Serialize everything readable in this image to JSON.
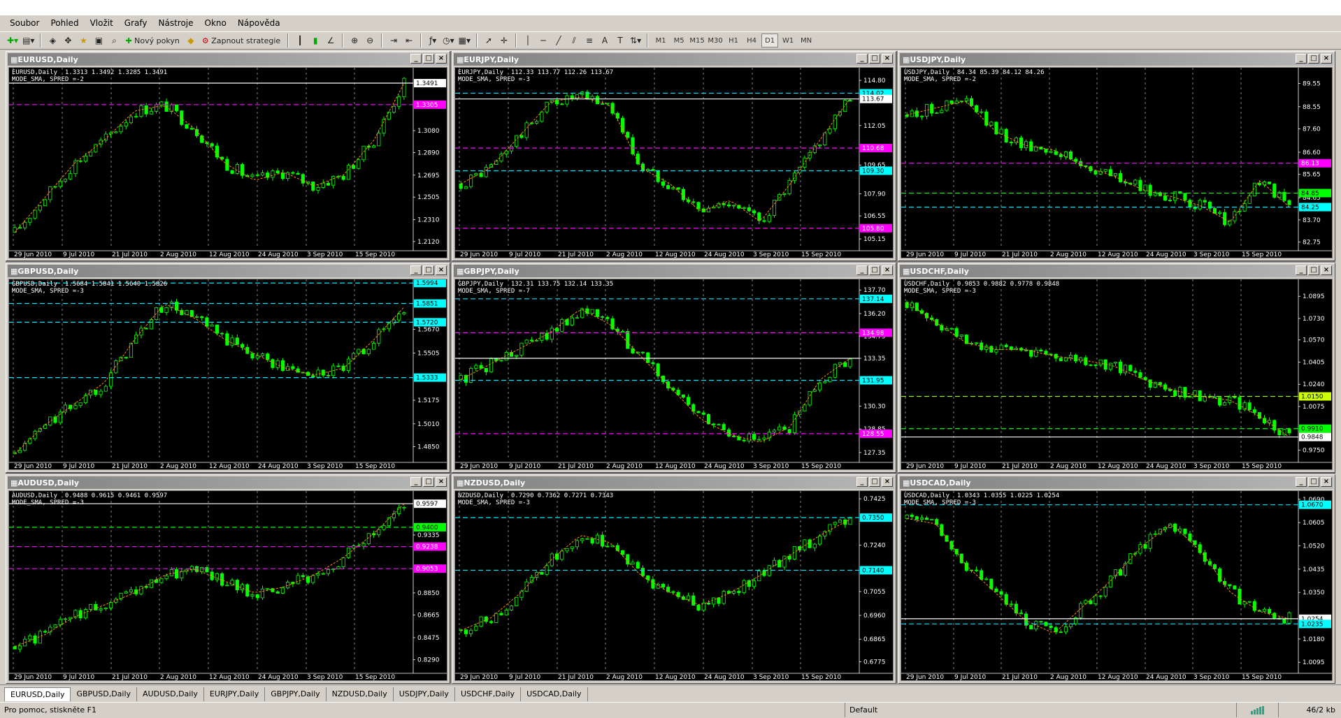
{
  "menu": [
    "Soubor",
    "Pohled",
    "Vložit",
    "Grafy",
    "Nástroje",
    "Okno",
    "Nápověda"
  ],
  "toolbar": {
    "new_order": "Nový pokyn",
    "strategies": "Zapnout strategie",
    "timeframes": [
      "M1",
      "M5",
      "M15",
      "M30",
      "H1",
      "H4",
      "D1",
      "W1",
      "MN"
    ]
  },
  "charts": [
    {
      "title": "EURUSD,Daily",
      "ohlc": "EURUSD,Daily  1.3313 1.3492 1.3285 1.3491",
      "mode": "MODE_SMA, SPRED =-2",
      "chart_data": {
        "type": "candlestick",
        "ylim": [
          1.2065,
          1.36
        ],
        "trend": [
          1.22,
          1.25,
          1.28,
          1.3,
          1.325,
          1.33,
          1.31,
          1.28,
          1.265,
          1.272,
          1.26,
          1.27,
          1.3,
          1.349
        ],
        "scale": [
          "1.3080",
          "1.2890",
          "1.2695",
          "1.2505",
          "1.2310",
          "1.2120"
        ],
        "levels": [
          {
            "v": 1.3491,
            "label": "1.3491",
            "color": "#ffffff",
            "bg": "#ffffff",
            "fg": "#000000"
          },
          {
            "v": 1.3305,
            "label": "1.3305",
            "color": "#ff00ff",
            "bg": "#ff00ff",
            "fg": "#ffffff"
          }
        ],
        "dates": [
          "29 Jun 2010",
          "9 Jul 2010",
          "21 Jul 2010",
          "2 Aug 2010",
          "12 Aug 2010",
          "24 Aug 2010",
          "3 Sep 2010",
          "15 Sep 2010"
        ]
      }
    },
    {
      "title": "EURJPY,Daily",
      "ohlc": "EURJPY,Daily  112.33 113.77 112.26 113.67",
      "mode": "MODE_SMA, SPRED =-3",
      "chart_data": {
        "type": "candlestick",
        "ylim": [
          104.6,
          115.4
        ],
        "trend": [
          108.5,
          109.5,
          111.5,
          113.5,
          113.8,
          113.3,
          109.5,
          108.5,
          106.8,
          107.5,
          106.2,
          108.5,
          111.2,
          113.7
        ],
        "scale": [
          "114.80",
          "112.05",
          "109.65",
          "107.90",
          "106.55",
          "105.15"
        ],
        "levels": [
          {
            "v": 114.02,
            "label": "114.02",
            "color": "#00e5ff",
            "bg": "#00ffff",
            "fg": "#000000"
          },
          {
            "v": 113.67,
            "label": "113.67",
            "color": "#ffffff",
            "bg": "#ffffff",
            "fg": "#000000"
          },
          {
            "v": 110.68,
            "label": "110.68",
            "color": "#ff00ff",
            "bg": "#ff00ff",
            "fg": "#ffffff"
          },
          {
            "v": 109.3,
            "label": "109.30",
            "color": "#00e5ff",
            "bg": "#00ffff",
            "fg": "#000000"
          },
          {
            "v": 105.8,
            "label": "105.80",
            "color": "#ff00ff",
            "bg": "#ff00ff",
            "fg": "#ffffff"
          }
        ],
        "dates": [
          "29 Jun 2010",
          "9 Jul 2010",
          "21 Jul 2010",
          "2 Aug 2010",
          "12 Aug 2010",
          "24 Aug 2010",
          "3 Sep 2010",
          "15 Sep 2010"
        ]
      }
    },
    {
      "title": "USDJPY,Daily",
      "ohlc": "USDJPY,Daily  84.34 85.39 84.12 84.26",
      "mode": "MODE_SMA, SPRED =-2",
      "chart_data": {
        "type": "candlestick",
        "ylim": [
          82.5,
          90.1
        ],
        "trend": [
          88.2,
          88.5,
          88.8,
          87.5,
          86.9,
          86.7,
          86,
          85.6,
          85,
          84.7,
          84.3,
          83.6,
          85.4,
          84.26
        ],
        "scale": [
          "89.55",
          "88.55",
          "87.60",
          "86.60",
          "85.65",
          "84.65",
          "83.70",
          "82.75"
        ],
        "levels": [
          {
            "v": 86.13,
            "label": "86.13",
            "color": "#ff00ff",
            "bg": "#ff00ff",
            "fg": "#ffffff"
          },
          {
            "v": 84.85,
            "label": "84.85",
            "color": "#00ff00",
            "bg": "#00ff00",
            "fg": "#000000"
          },
          {
            "v": 84.25,
            "label": "84.25",
            "color": "#00e5ff",
            "bg": "#00ffff",
            "fg": "#000000"
          }
        ],
        "dates": [
          "29 Jun 2010",
          "9 Jul 2010",
          "21 Jul 2010",
          "2 Aug 2010",
          "12 Aug 2010",
          "24 Aug 2010",
          "3 Sep 2010",
          "15 Sep 2010"
        ]
      }
    },
    {
      "title": "GBPUSD,Daily",
      "ohlc": "GBPUSD,Daily  1.5684 1.5841 1.5640 1.5826",
      "mode": "MODE_SMA, SPRED =-3",
      "chart_data": {
        "type": "candlestick",
        "ylim": [
          1.476,
          1.6
        ],
        "trend": [
          1.48,
          1.5,
          1.515,
          1.53,
          1.56,
          1.585,
          1.575,
          1.56,
          1.55,
          1.54,
          1.535,
          1.54,
          1.56,
          1.5826
        ],
        "scale": [
          "1.5670",
          "1.5505",
          "1.5175",
          "1.5010",
          "1.4850"
        ],
        "levels": [
          {
            "v": 1.5994,
            "label": "1.5994",
            "color": "#00e5ff",
            "bg": "#00ffff",
            "fg": "#000000"
          },
          {
            "v": 1.5851,
            "label": "1.5851",
            "color": "#00e5ff",
            "bg": "#00ffff",
            "fg": "#000000"
          },
          {
            "v": 1.572,
            "label": "1.5720",
            "color": "#00e5ff",
            "bg": "#00ffff",
            "fg": "#000000"
          },
          {
            "v": 1.5333,
            "label": "1.5333",
            "color": "#00e5ff",
            "bg": "#00ffff",
            "fg": "#000000"
          }
        ],
        "dates": [
          "29 Jun 2010",
          "9 Jul 2010",
          "21 Jul 2010",
          "2 Aug 2010",
          "12 Aug 2010",
          "24 Aug 2010",
          "3 Sep 2010",
          "15 Sep 2010"
        ]
      }
    },
    {
      "title": "GBPJPY,Daily",
      "ohlc": "GBPJPY,Daily  132.31 133.75 132.14 133.35",
      "mode": "MODE_SMA, SPRED =-7",
      "chart_data": {
        "type": "candlestick",
        "ylim": [
          126.9,
          138.2
        ],
        "trend": [
          132,
          133,
          134,
          135,
          136.5,
          135.5,
          133.5,
          131.5,
          129.5,
          128.5,
          128,
          129,
          132,
          133.35
        ],
        "scale": [
          "137.70",
          "136.20",
          "134.75",
          "133.35",
          "130.30",
          "128.85",
          "127.35"
        ],
        "levels": [
          {
            "v": 137.14,
            "label": "137.14",
            "color": "#00e5ff",
            "bg": "#00ffff",
            "fg": "#000000"
          },
          {
            "v": 134.98,
            "label": "134.98",
            "color": "#ff00ff",
            "bg": "#ff00ff",
            "fg": "#ffffff"
          },
          {
            "v": 133.35,
            "label": "",
            "color": "#ffffff",
            "bg": "",
            "fg": ""
          },
          {
            "v": 131.95,
            "label": "131.95",
            "color": "#00e5ff",
            "bg": "#00ffff",
            "fg": "#000000"
          },
          {
            "v": 128.55,
            "label": "128.55",
            "color": "#ff00ff",
            "bg": "#ff00ff",
            "fg": "#ffffff"
          }
        ],
        "dates": [
          "29 Jun 2010",
          "9 Jul 2010",
          "21 Jul 2010",
          "2 Aug 2010",
          "12 Aug 2010",
          "24 Aug 2010",
          "3 Sep 2010",
          "15 Sep 2010"
        ]
      }
    },
    {
      "title": "USDCHF,Daily",
      "ohlc": "USDCHF,Daily  0.9853 0.9882 0.9778 0.9848",
      "mode": "MODE_SMA, SPRED =-3",
      "chart_data": {
        "type": "candlestick",
        "ylim": [
          0.968,
          1.1
        ],
        "trend": [
          1.085,
          1.07,
          1.055,
          1.05,
          1.05,
          1.045,
          1.042,
          1.038,
          1.028,
          1.02,
          1.015,
          1.012,
          1.0,
          0.9848
        ],
        "scale": [
          "1.0895",
          "1.0730",
          "1.0570",
          "1.0405",
          "1.0240",
          "1.0075",
          "0.9750"
        ],
        "levels": [
          {
            "v": 1.015,
            "label": "1.0150",
            "color": "#9aff00",
            "bg": "#ccff00",
            "fg": "#000000"
          },
          {
            "v": 0.991,
            "label": "0.9910",
            "color": "#00ff00",
            "bg": "#00ff00",
            "fg": "#000000"
          },
          {
            "v": 0.9848,
            "label": "0.9848",
            "color": "#ffffff",
            "bg": "#ffffff",
            "fg": "#000000"
          }
        ],
        "dates": [
          "29 Jun 2010",
          "9 Jul 2010",
          "21 Jul 2010",
          "2 Aug 2010",
          "12 Aug 2010",
          "24 Aug 2010",
          "3 Sep 2010",
          "15 Sep 2010"
        ]
      }
    },
    {
      "title": "AUDUSD,Daily",
      "ohlc": "AUDUSD,Daily  0.9488 0.9615 0.9461 0.9597",
      "mode": "MODE_SMA, SPRED =-3",
      "chart_data": {
        "type": "candlestick",
        "ylim": [
          0.82,
          0.968
        ],
        "trend": [
          0.84,
          0.85,
          0.865,
          0.875,
          0.885,
          0.9,
          0.905,
          0.895,
          0.885,
          0.89,
          0.9,
          0.915,
          0.935,
          0.9597
        ],
        "scale": [
          "0.9335",
          "0.8850",
          "0.8665",
          "0.8475",
          "0.8290"
        ],
        "levels": [
          {
            "v": 0.9597,
            "label": "0.9597",
            "color": "#ffffff",
            "bg": "#ffffff",
            "fg": "#000000"
          },
          {
            "v": 0.94,
            "label": "0.9400",
            "color": "#00ff00",
            "bg": "#00ff00",
            "fg": "#000000"
          },
          {
            "v": 0.9238,
            "label": "0.9238",
            "color": "#ff00ff",
            "bg": "#ff00ff",
            "fg": "#ffffff"
          },
          {
            "v": 0.9053,
            "label": "0.9053",
            "color": "#ff00ff",
            "bg": "#ff00ff",
            "fg": "#ffffff"
          }
        ],
        "dates": [
          "29 Jun 2010",
          "9 Jul 2010",
          "21 Jul 2010",
          "2 Aug 2010",
          "12 Aug 2010",
          "24 Aug 2010",
          "3 Sep 2010",
          "15 Sep 2010"
        ]
      }
    },
    {
      "title": "NZDUSD,Daily",
      "ohlc": "NZDUSD,Daily  0.7290 0.7362 0.7271 0.7343",
      "mode": "MODE_SMA, SPRED =-3",
      "chart_data": {
        "type": "candlestick",
        "ylim": [
          0.674,
          0.7445
        ],
        "trend": [
          0.69,
          0.695,
          0.705,
          0.718,
          0.728,
          0.725,
          0.712,
          0.705,
          0.7,
          0.705,
          0.712,
          0.72,
          0.728,
          0.7343
        ],
        "scale": [
          "0.7425",
          "0.7240",
          "0.7055",
          "0.6960",
          "0.6865",
          "0.6775"
        ],
        "levels": [
          {
            "v": 0.735,
            "label": "0.7350",
            "color": "#00e5ff",
            "bg": "#00ffff",
            "fg": "#000000"
          },
          {
            "v": 0.714,
            "label": "0.7140",
            "color": "#00e5ff",
            "bg": "#00ffff",
            "fg": "#000000"
          }
        ],
        "dates": [
          "29 Jun 2010",
          "9 Jul 2010",
          "21 Jul 2010",
          "2 Aug 2010",
          "12 Aug 2010",
          "24 Aug 2010",
          "3 Sep 2010",
          "15 Sep 2010"
        ]
      }
    },
    {
      "title": "USDCAD,Daily",
      "ohlc": "USDCAD,Daily  1.0343 1.0355 1.0225 1.0254",
      "mode": "MODE_SMA, SPRED =-3",
      "chart_data": {
        "type": "candlestick",
        "ylim": [
          1.0065,
          1.071
        ],
        "trend": [
          1.062,
          1.06,
          1.045,
          1.035,
          1.025,
          1.02,
          1.03,
          1.04,
          1.052,
          1.06,
          1.05,
          1.035,
          1.028,
          1.0254
        ],
        "scale": [
          "1.0690",
          "1.0605",
          "1.0520",
          "1.0435",
          "1.0350",
          "1.0180",
          "1.0095"
        ],
        "levels": [
          {
            "v": 1.067,
            "label": "1.0670",
            "color": "#00e5ff",
            "bg": "#00ffff",
            "fg": "#000000"
          },
          {
            "v": 1.0254,
            "label": "1.0254",
            "color": "#ffffff",
            "bg": "#ffffff",
            "fg": "#000000"
          },
          {
            "v": 1.0235,
            "label": "1.0235",
            "color": "#00e5ff",
            "bg": "#00ffff",
            "fg": "#000000"
          }
        ],
        "dates": [
          "29 Jun 2010",
          "9 Jul 2010",
          "21 Jul 2010",
          "2 Aug 2010",
          "12 Aug 2010",
          "24 Aug 2010",
          "3 Sep 2010",
          "15 Sep 2010"
        ]
      }
    }
  ],
  "tabs": [
    "EURUSD,Daily",
    "GBPUSD,Daily",
    "AUDUSD,Daily",
    "EURJPY,Daily",
    "GBPJPY,Daily",
    "NZDUSD,Daily",
    "USDJPY,Daily",
    "USDCHF,Daily",
    "USDCAD,Daily"
  ],
  "status": {
    "help": "Pro pomoc, stiskněte F1",
    "profile": "Default",
    "traffic": "46/2 kb"
  },
  "colors": {
    "bull": "#00ff00",
    "bear": "#000000",
    "ma": "#ff8c00",
    "magenta": "#ff00ff",
    "cyan": "#00e5ff",
    "grid": "#ffffff"
  }
}
